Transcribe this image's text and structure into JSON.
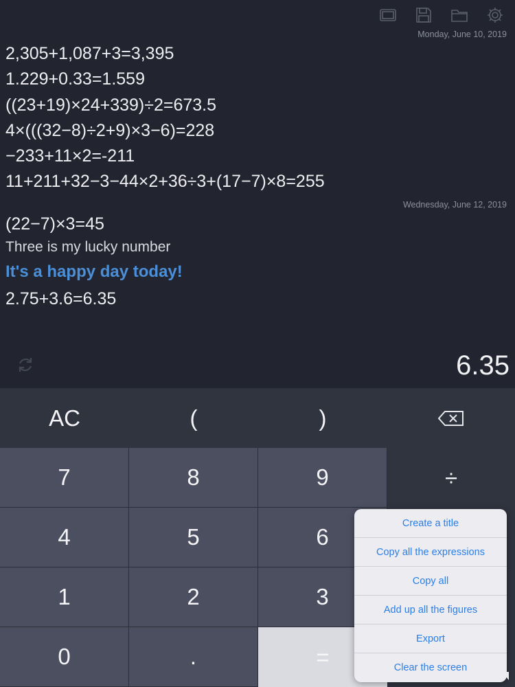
{
  "toolbar": {
    "icons": [
      "fullscreen-icon",
      "save-icon",
      "folder-icon",
      "gear-icon"
    ]
  },
  "history": {
    "sections": [
      {
        "date": "Monday, June 10, 2019",
        "lines": [
          {
            "text": "2,305+1,087+3=3,395",
            "kind": "expr"
          },
          {
            "text": "1.229+0.33=1.559",
            "kind": "expr"
          },
          {
            "text": "((23+19)×24+339)÷2=673.5",
            "kind": "expr"
          },
          {
            "text": "4×(((32−8)÷2+9)×3−6)=228",
            "kind": "expr"
          },
          {
            "text": "−233+11×2=-211",
            "kind": "expr"
          },
          {
            "text": "11+211+32−3−44×2+36÷3+(17−7)×8=255",
            "kind": "expr"
          }
        ]
      },
      {
        "date": "Wednesday, June 12, 2019",
        "lines": [
          {
            "text": "(22−7)×3=45",
            "kind": "expr"
          },
          {
            "text": "Three is my lucky number",
            "kind": "note"
          },
          {
            "text": "It's a happy day today!",
            "kind": "title"
          },
          {
            "text": "2.75+3.6=6.35",
            "kind": "expr"
          }
        ]
      }
    ]
  },
  "display": {
    "result": "6.35",
    "refresh_icon": "refresh-icon"
  },
  "keypad": {
    "row_fn": [
      "AC",
      "(",
      ")",
      "⌫"
    ],
    "row1": [
      "7",
      "8",
      "9",
      "÷"
    ],
    "row2": [
      "4",
      "5",
      "6"
    ],
    "row3": [
      "1",
      "2",
      "3"
    ],
    "row4": [
      "0",
      ".",
      "="
    ]
  },
  "menu": {
    "items": [
      "Create a title",
      "Copy all the expressions",
      "Copy all",
      "Add up all the figures",
      "Export",
      "Clear the screen"
    ]
  },
  "colors": {
    "background": "#22252f",
    "keypad": "#30343f",
    "number_key": "#4c4f60",
    "title_text": "#4b8fd8",
    "menu_text": "#2a7ee8"
  }
}
